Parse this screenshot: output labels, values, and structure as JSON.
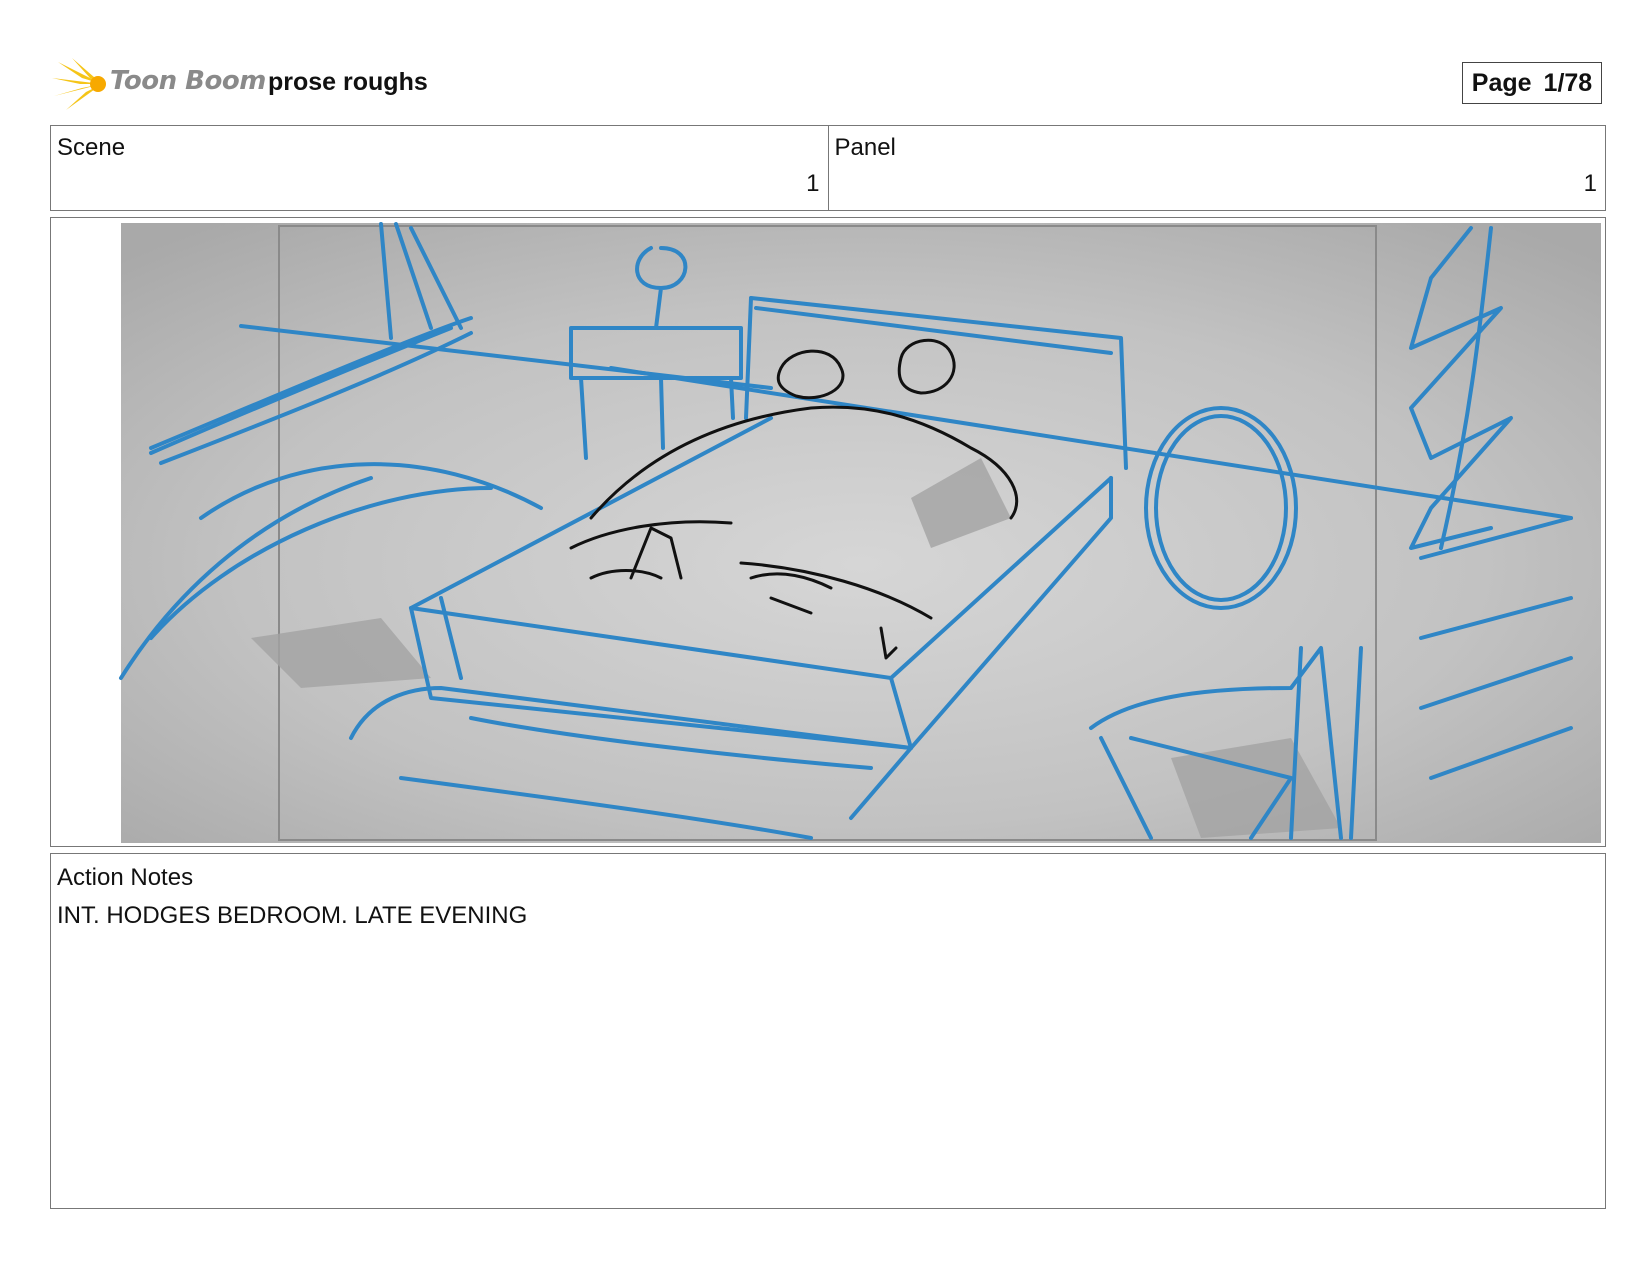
{
  "header": {
    "logo_text": "Toon Boom",
    "project_title": "prose roughs",
    "page_label": "Page",
    "page_number": "1/78"
  },
  "scene": {
    "label": "Scene",
    "value": "1"
  },
  "panel": {
    "label": "Panel",
    "value": "1"
  },
  "action_notes": {
    "label": "Action Notes",
    "text": "INT. HODGES BEDROOM. LATE EVENING"
  },
  "colors": {
    "sketch_blue": "#2f86c6",
    "sketch_black": "#111111",
    "logo_yellow": "#f5c518",
    "background_gray": "#c4c4c4"
  }
}
